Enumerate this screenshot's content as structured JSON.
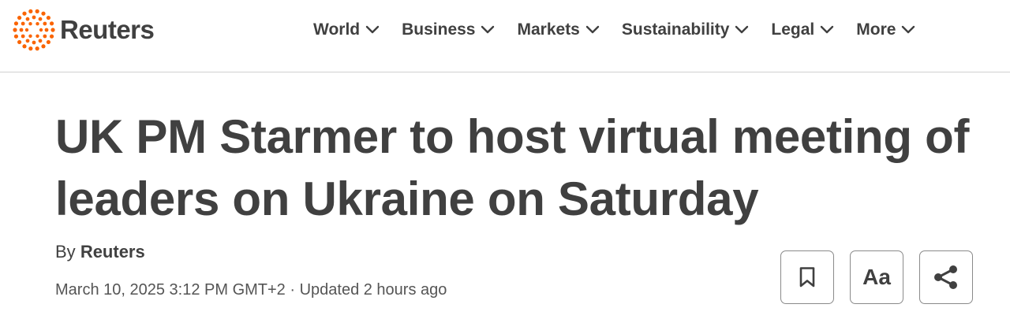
{
  "header": {
    "logo_text": "Reuters",
    "logo_color": "#fa6400",
    "nav": [
      {
        "label": "World",
        "icon": "chevron-down-icon"
      },
      {
        "label": "Business",
        "icon": "chevron-down-icon"
      },
      {
        "label": "Markets",
        "icon": "chevron-down-icon"
      },
      {
        "label": "Sustainability",
        "icon": "chevron-down-icon"
      },
      {
        "label": "Legal",
        "icon": "chevron-down-icon"
      },
      {
        "label": "More",
        "icon": "chevron-down-icon"
      }
    ]
  },
  "article": {
    "headline_line1": "UK PM Starmer to host virtual meeting of",
    "headline_line2": "leaders on Ukraine on Saturday",
    "by_prefix": "By",
    "author": "Reuters",
    "dateline": "March 10, 2025 3:12 PM GMT+2 · Updated 2 hours ago"
  },
  "actions": {
    "save_icon": "bookmark-icon",
    "text_size_label": "Aa",
    "share_icon": "share-icon"
  }
}
